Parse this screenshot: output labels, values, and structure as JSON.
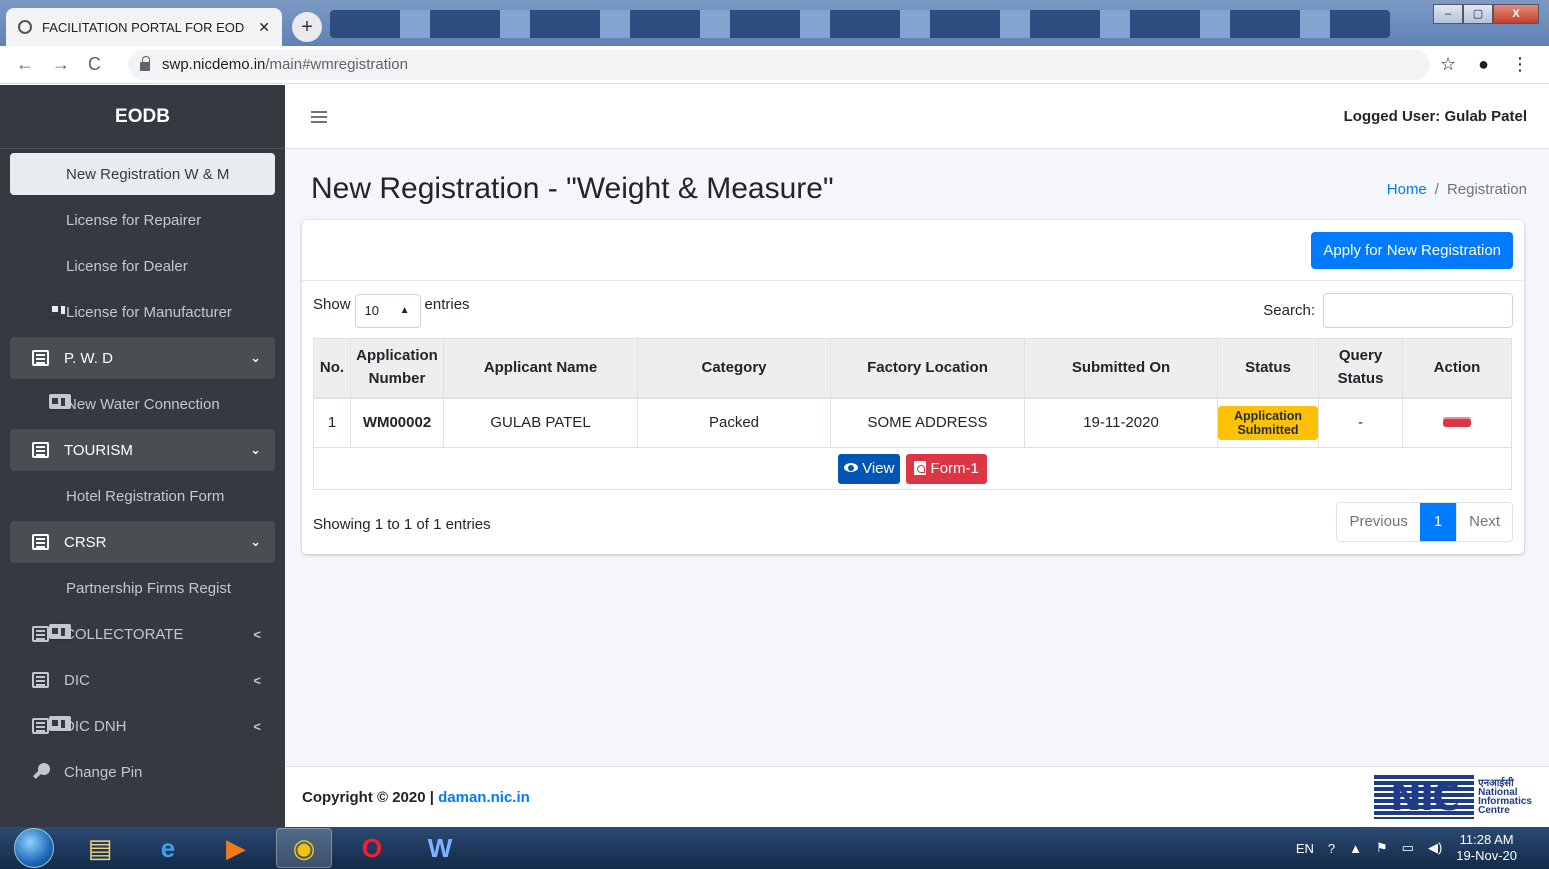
{
  "browser": {
    "tab_title": "FACILITATION PORTAL FOR EOD",
    "tab_close": "✕",
    "new_tab": "+",
    "url_host": "swp.nicdemo.in",
    "url_path": "/main#wmregistration",
    "back": "←",
    "forward": "→",
    "reload": "C",
    "star": "☆",
    "menu": "⋮",
    "account": "●",
    "min": "–",
    "max": "▢",
    "close": "X"
  },
  "sidebar": {
    "brand": "EODB",
    "items": [
      {
        "label": "New Registration W & M",
        "icon": "id-card-icon",
        "type": "active"
      },
      {
        "label": "License for Repairer",
        "icon": "id-card-icon",
        "type": "plain"
      },
      {
        "label": "License for Dealer",
        "icon": "id-card-icon",
        "type": "plain"
      },
      {
        "label": "License for Manufacturer",
        "icon": "id-card-icon",
        "type": "plain"
      },
      {
        "label": "P. W. D",
        "icon": "list-icon",
        "type": "group",
        "caret": "⌄"
      },
      {
        "label": "New Water Connection",
        "icon": "id-card-icon",
        "type": "plain"
      },
      {
        "label": "TOURISM",
        "icon": "list-icon",
        "type": "group",
        "caret": "⌄"
      },
      {
        "label": "Hotel Registration Form",
        "icon": "id-card-icon",
        "type": "plain"
      },
      {
        "label": "CRSR",
        "icon": "list-icon",
        "type": "group",
        "caret": "⌄"
      },
      {
        "label": "Partnership Firms Regist",
        "icon": "id-card-icon",
        "type": "plain"
      },
      {
        "label": "COLLECTORATE",
        "icon": "list-icon",
        "type": "plain",
        "caret": "<"
      },
      {
        "label": "DIC",
        "icon": "list-icon",
        "type": "plain",
        "caret": "<"
      },
      {
        "label": "DIC DNH",
        "icon": "list-icon",
        "type": "plain",
        "caret": "<"
      },
      {
        "label": "Change Pin",
        "icon": "key-icon",
        "type": "plain"
      }
    ]
  },
  "header": {
    "logged_user": "Logged User: Gulab Patel"
  },
  "page": {
    "title": "New Registration - \"Weight & Measure\"",
    "breadcrumb_home": "Home",
    "breadcrumb_sep": "/",
    "breadcrumb_current": "Registration",
    "apply_button": "Apply for New Registration"
  },
  "table_controls": {
    "show_label": "Show",
    "entries_value": "10",
    "entries_label": "entries",
    "search_label": "Search:"
  },
  "table": {
    "headers": [
      "No.",
      "Application Number",
      "Applicant Name",
      "Category",
      "Factory Location",
      "Submitted On",
      "Status",
      "Query Status",
      "Action"
    ],
    "rows": [
      {
        "no": "1",
        "app_number": "WM00002",
        "applicant": "GULAB PATEL",
        "category": "Packed",
        "location": "SOME ADDRESS",
        "submitted": "19-11-2020",
        "status": "Application Submitted",
        "query_status": "-"
      }
    ],
    "view_button": "View",
    "form_button": "Form-1"
  },
  "pagination": {
    "info": "Showing 1 to 1 of 1 entries",
    "previous": "Previous",
    "current": "1",
    "next": "Next"
  },
  "footer": {
    "copyright_prefix": "Copyright © 2020 | ",
    "copyright_link": "daman.nic.in",
    "nic_logo_text": "NIC",
    "nic_hindi": "एनआईसी",
    "nic_line1": "National",
    "nic_line2": "Informatics",
    "nic_line3": "Centre"
  },
  "taskbar": {
    "lang": "EN",
    "time": "11:28 AM",
    "date": "19-Nov-20"
  }
}
